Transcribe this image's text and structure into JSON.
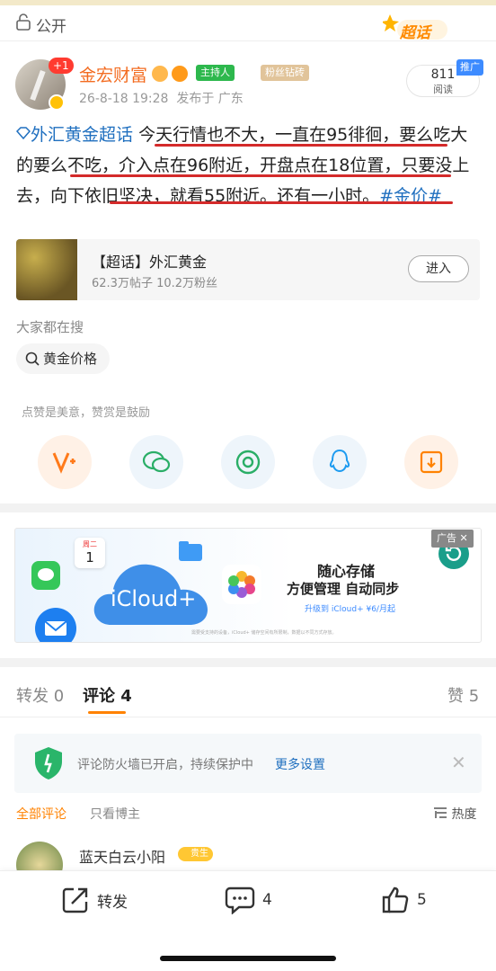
{
  "header": {
    "visibility": "公开",
    "supertopic_badge": "超话"
  },
  "post": {
    "author": "金宏财富",
    "notification_count": "+1",
    "host_badge": "主持人",
    "fan_badge": "粉丝钻砖",
    "timestamp": "26-8-18 19:28",
    "location": "发布于 广东",
    "reads": {
      "count": "811",
      "label": "阅读"
    },
    "promo_tag": "推广",
    "topic": "外汇黄金超话",
    "body_seg1": "今天行情也不大，一直在95徘徊，要么吃大的要么不吃，介入点在96附近，开盘点在18位置，只要没上去，向下依旧坚决，就看55附近。还有一小时。",
    "hashtag": "#金价#"
  },
  "supertopic_card": {
    "title": "【超话】外汇黄金",
    "stats": "62.3万帖子  10.2万粉丝",
    "enter_label": "进入"
  },
  "search": {
    "title": "大家都在搜",
    "chip": "黄金价格"
  },
  "share": {
    "hint": "点赞是美意，赞赏是鼓励",
    "icons": [
      "weibo-v-icon",
      "wechat-icon",
      "moments-icon",
      "qq-icon",
      "save-image-icon"
    ]
  },
  "ad": {
    "label": "广告",
    "cloud_text": "iCloud+",
    "calendar_day": "周二",
    "calendar_date": "1",
    "headline1": "随心存储",
    "headline2": "方便管理 自动同步",
    "sub": "升级到 iCloud+ ¥6/月起",
    "fineprint": "需要受支持的设备，iCloud+ 储存空间有所限制，数据以不同方式存放。"
  },
  "tabs": {
    "repost": "转发 0",
    "comments": "评论 4",
    "likes": "赞 5"
  },
  "firewall": {
    "text": "评论防火墙已开启，持续保护中",
    "link": "更多设置"
  },
  "filters": {
    "all": "全部评论",
    "owner_only": "只看博主",
    "sort": "热度"
  },
  "comment": {
    "name": "蓝天白云小阳",
    "badge": "贵生"
  },
  "bottom": {
    "repost": "转发",
    "comments": "4",
    "likes": "5"
  },
  "colors": {
    "accent": "#ff8200",
    "author": "#f36c21",
    "link": "#1f6fbf",
    "underline": "#d42a2a"
  }
}
